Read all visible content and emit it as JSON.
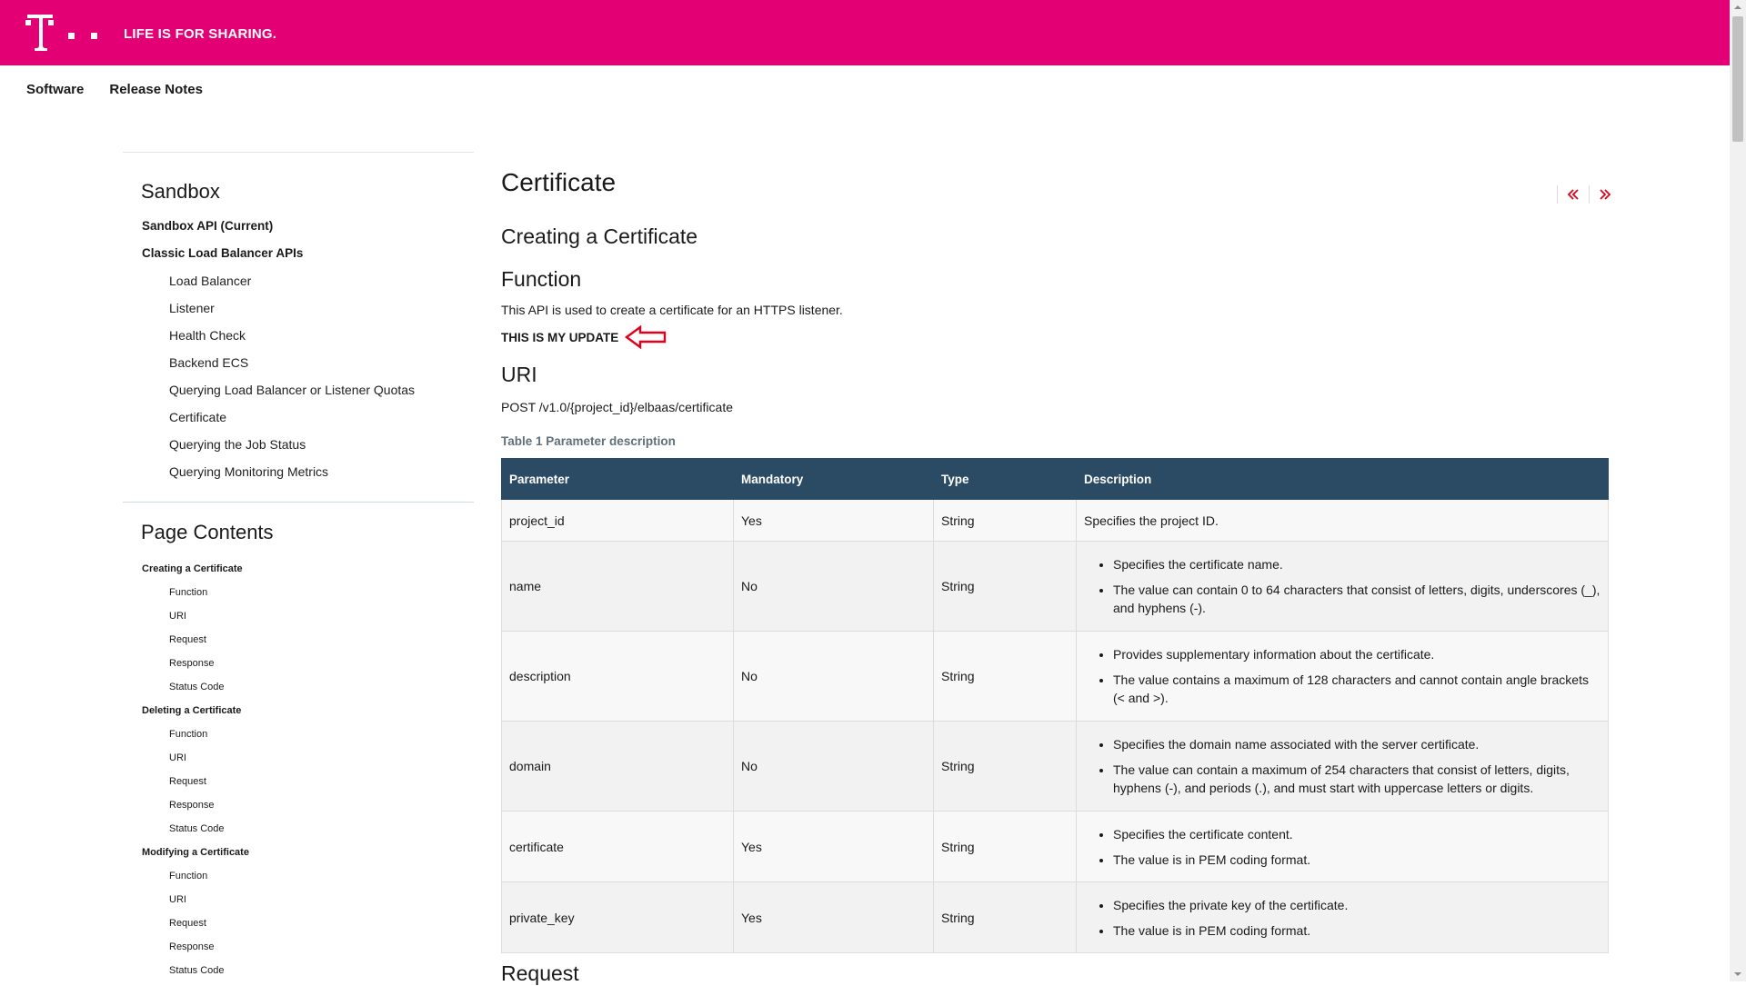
{
  "brand": {
    "logo_icon": "t-logo-icon",
    "tagline": "LIFE IS FOR SHARING.",
    "color": "#e20074"
  },
  "nav": {
    "items": [
      "Software",
      "Release Notes"
    ]
  },
  "sidebar": {
    "title": "Sandbox",
    "items": [
      {
        "label": "Sandbox API (Current)",
        "level": 1
      },
      {
        "label": "Classic Load Balancer APIs",
        "level": 1
      },
      {
        "label": "Load Balancer",
        "level": 2
      },
      {
        "label": "Listener",
        "level": 2
      },
      {
        "label": "Health Check",
        "level": 2
      },
      {
        "label": "Backend ECS",
        "level": 2
      },
      {
        "label": "Querying Load Balancer or Listener Quotas",
        "level": 2
      },
      {
        "label": "Certificate",
        "level": 2
      },
      {
        "label": "Querying the Job Status",
        "level": 2
      },
      {
        "label": "Querying Monitoring Metrics",
        "level": 2
      }
    ]
  },
  "toc": {
    "title": "Page Contents",
    "items": [
      {
        "label": "Creating a Certificate",
        "level": 1
      },
      {
        "label": "Function",
        "level": 2
      },
      {
        "label": "URI",
        "level": 2
      },
      {
        "label": "Request",
        "level": 2
      },
      {
        "label": "Response",
        "level": 2
      },
      {
        "label": "Status Code",
        "level": 2
      },
      {
        "label": "Deleting a Certificate",
        "level": 1
      },
      {
        "label": "Function",
        "level": 2
      },
      {
        "label": "URI",
        "level": 2
      },
      {
        "label": "Request",
        "level": 2
      },
      {
        "label": "Response",
        "level": 2
      },
      {
        "label": "Status Code",
        "level": 2
      },
      {
        "label": "Modifying a Certificate",
        "level": 1
      },
      {
        "label": "Function",
        "level": 2
      },
      {
        "label": "URI",
        "level": 2
      },
      {
        "label": "Request",
        "level": 2
      },
      {
        "label": "Response",
        "level": 2
      },
      {
        "label": "Status Code",
        "level": 2
      }
    ]
  },
  "main": {
    "title": "Certificate",
    "section_title": "Creating a Certificate",
    "function_heading": "Function",
    "function_text": "This API is used to create a certificate for an HTTPS listener.",
    "update_note": "THIS IS MY UPDATE",
    "uri_heading": "URI",
    "uri_text": "POST /v1.0/{project_id}/elbaas/certificate",
    "table_caption": "Table 1 Parameter description",
    "request_heading": "Request",
    "pager": {
      "prev_icon": "double-chevron-left-icon",
      "next_icon": "double-chevron-right-icon",
      "color": "#e2001a"
    }
  },
  "table": {
    "header_color": "#2b4a63",
    "columns": [
      "Parameter",
      "Mandatory",
      "Type",
      "Description"
    ],
    "rows": [
      {
        "parameter": "project_id",
        "mandatory": "Yes",
        "type": "String",
        "description": [
          "Specifies the project ID."
        ]
      },
      {
        "parameter": "name",
        "mandatory": "No",
        "type": "String",
        "description": [
          "Specifies the certificate name.",
          "The value can contain 0 to 64 characters that consist of letters, digits, underscores (_), and hyphens (-)."
        ]
      },
      {
        "parameter": "description",
        "mandatory": "No",
        "type": "String",
        "description": [
          "Provides supplementary information about the certificate.",
          "The value contains a maximum of 128 characters and cannot contain angle brackets (< and >)."
        ]
      },
      {
        "parameter": "domain",
        "mandatory": "No",
        "type": "String",
        "description": [
          "Specifies the domain name associated with the server certificate.",
          "The value can contain a maximum of 254 characters that consist of letters, digits, hyphens (-), and periods (.), and must start with uppercase letters or digits."
        ]
      },
      {
        "parameter": "certificate",
        "mandatory": "Yes",
        "type": "String",
        "description": [
          "Specifies the certificate content.",
          "The value is in PEM coding format."
        ]
      },
      {
        "parameter": "private_key",
        "mandatory": "Yes",
        "type": "String",
        "description": [
          "Specifies the private key of the certificate.",
          "The value is in PEM coding format."
        ]
      }
    ]
  }
}
